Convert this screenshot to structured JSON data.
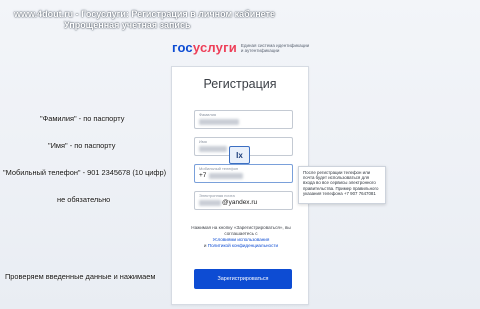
{
  "watermark": {
    "line1": "www.4dout.ru - Госуслуги: Регистрация в личном кабинете",
    "line2": "Упрощенная учетная запись"
  },
  "logo": {
    "part1": "гос",
    "part2": "услуги",
    "subtitle": "Единая система идентификации и аутентификации"
  },
  "form": {
    "title": "Регистрация",
    "surname_label": "Фамилия",
    "name_label": "Имя",
    "phone_label": "Мобильный телефон",
    "phone_prefix": "+7",
    "email_label": "Электронная почта",
    "email_suffix": "@yandex.ru",
    "note": "Нажимая на кнопку «Зарегистрироваться», вы соглашаетесь с",
    "terms_link": "Условиями использования",
    "and": "и",
    "privacy_link": "Политикой конфиденциальности",
    "submit_label": "Зарегистрироваться"
  },
  "tooltip": {
    "text": "После регистрации телефон или почта будет использоваться для входа во все сервисы электронного правительства. Пример правильного указания телефона +7 907 7647081"
  },
  "badge": {
    "label": "Ix"
  },
  "annotations": {
    "surname": "\"Фамилия\" - по паспорту",
    "name": "\"Имя\" - по паспорту",
    "phone": "\"Мобильный телефон\" - 901 2345678 (10 цифр)",
    "optional": "не обязательно",
    "check": "Проверяем введенные данные и нажимаем"
  },
  "colors": {
    "brand_blue": "#0d4cd3",
    "brand_red": "#ee3f58"
  }
}
